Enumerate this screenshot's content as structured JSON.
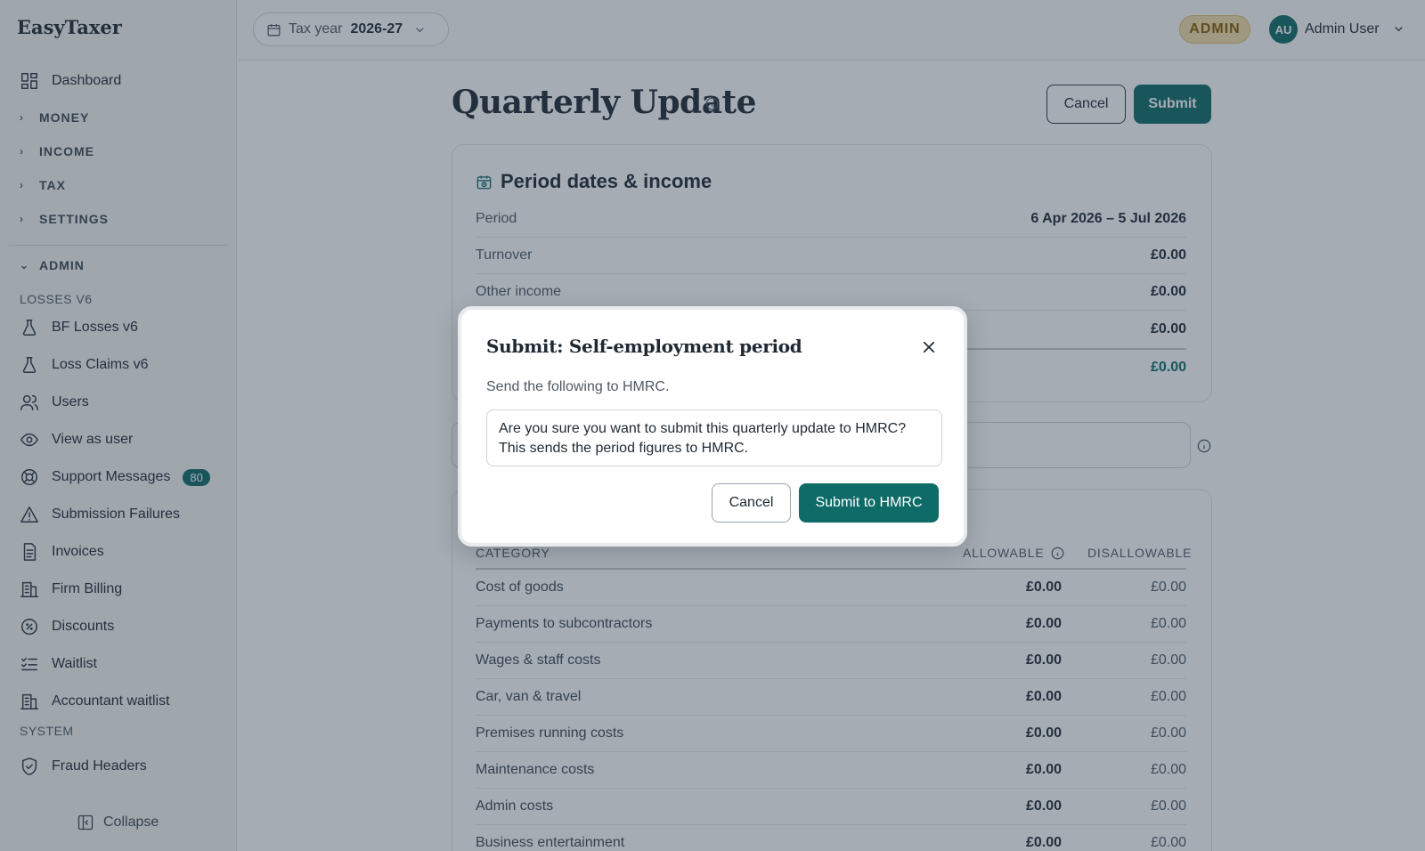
{
  "app": {
    "brand": "EasyTaxer"
  },
  "sidebar": {
    "dashboard": "Dashboard",
    "groups": {
      "money": "MONEY",
      "income": "INCOME",
      "tax": "TAX",
      "settings": "SETTINGS",
      "admin": "ADMIN"
    },
    "losses_label": "LOSSES V6",
    "items": {
      "bf_losses": "BF Losses v6",
      "loss_claims": "Loss Claims v6",
      "users": "Users",
      "view_as_user": "View as user",
      "support_messages": "Support Messages",
      "support_count": "80",
      "submission_failures": "Submission Failures",
      "invoices": "Invoices",
      "firm_billing": "Firm Billing",
      "discounts": "Discounts",
      "waitlist": "Waitlist",
      "accountant_waitlist": "Accountant waitlist"
    },
    "system_label": "SYSTEM",
    "fraud_headers": "Fraud Headers",
    "collapse": "Collapse"
  },
  "topbar": {
    "tax_year_label": "Tax year",
    "tax_year_value": "2026-27",
    "role_badge": "ADMIN",
    "avatar_initials": "AU",
    "user_name": "Admin User"
  },
  "page": {
    "title": "Quarterly Update",
    "cancel": "Cancel",
    "submit": "Submit"
  },
  "period_card": {
    "title": "Period dates & income",
    "rows": [
      {
        "label": "Period",
        "value": "6 Apr 2026 – 5 Jul 2026"
      },
      {
        "label": "Turnover",
        "value": "£0.00"
      },
      {
        "label": "Other income",
        "value": "£0.00"
      },
      {
        "label": "",
        "value": "£0.00"
      }
    ],
    "total_value": "£0.00"
  },
  "expenses": {
    "headers": {
      "category": "CATEGORY",
      "allowable": "ALLOWABLE",
      "disallowable": "DISALLOWABLE"
    },
    "rows": [
      {
        "category": "Cost of goods",
        "allowable": "£0.00",
        "disallowable": "£0.00"
      },
      {
        "category": "Payments to subcontractors",
        "allowable": "£0.00",
        "disallowable": "£0.00"
      },
      {
        "category": "Wages & staff costs",
        "allowable": "£0.00",
        "disallowable": "£0.00"
      },
      {
        "category": "Car, van & travel",
        "allowable": "£0.00",
        "disallowable": "£0.00"
      },
      {
        "category": "Premises running costs",
        "allowable": "£0.00",
        "disallowable": "£0.00"
      },
      {
        "category": "Maintenance costs",
        "allowable": "£0.00",
        "disallowable": "£0.00"
      },
      {
        "category": "Admin costs",
        "allowable": "£0.00",
        "disallowable": "£0.00"
      },
      {
        "category": "Business entertainment",
        "allowable": "£0.00",
        "disallowable": "£0.00"
      }
    ]
  },
  "modal": {
    "title": "Submit: Self-employment period",
    "subtitle": "Send the following to HMRC.",
    "message": "Are you sure you want to submit this quarterly update to HMRC? This sends the period figures to HMRC.",
    "cancel": "Cancel",
    "confirm": "Submit to HMRC"
  },
  "colors": {
    "accent": "#0e6b68",
    "admin_badge": "#f5dfa9"
  }
}
